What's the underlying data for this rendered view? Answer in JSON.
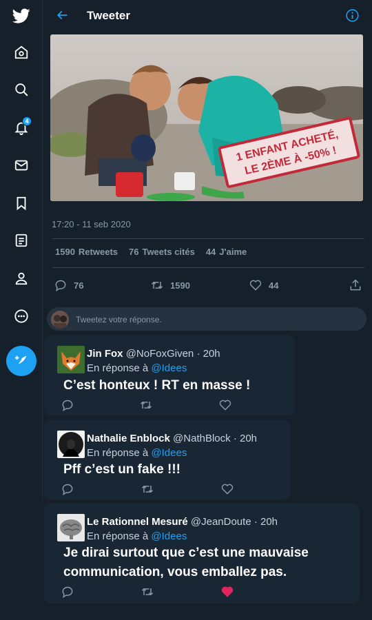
{
  "header": {
    "title": "Tweeter"
  },
  "sidebar": {
    "items": [
      {
        "name": "home"
      },
      {
        "name": "explore"
      },
      {
        "name": "notifications",
        "badge": "4"
      },
      {
        "name": "messages"
      },
      {
        "name": "bookmarks"
      },
      {
        "name": "lists"
      },
      {
        "name": "profile"
      },
      {
        "name": "more"
      }
    ]
  },
  "tweet": {
    "image_text_line1": "1 ENFANT ACHETÉ,",
    "image_text_line2": "LE 2ÈME À -50% !",
    "timestamp": "17:20 - 11 seb 2020",
    "stats": {
      "retweets_count": "1590",
      "retweets_label": "Retweets",
      "quotes_count": "76",
      "quotes_label": "Tweets cités",
      "likes_count": "44",
      "likes_label": "J'aime"
    },
    "actions": {
      "replies": "76",
      "retweets": "1590",
      "likes": "44"
    }
  },
  "reply_box": {
    "placeholder": "Tweetez votre réponse."
  },
  "replies": [
    {
      "name": "Jin Fox",
      "handle": "@NoFoxGiven",
      "time": "· 20h",
      "in_reply_prefix": "En réponse à",
      "mention": "@Idees",
      "text": "C’est honteux ! RT en masse !"
    },
    {
      "name": "Nathalie Enblock",
      "handle": "@NathBlock",
      "time": "· 20h",
      "in_reply_prefix": "En réponse à",
      "mention": "@Idees",
      "text": "Pff c’est un fake !!!"
    },
    {
      "name": "Le Rationnel Mesuré",
      "handle": "@JeanDoute",
      "time": "· 20h",
      "in_reply_prefix": "En réponse à",
      "mention": "@Idees",
      "text_line1": "Je dirai surtout que c’est une mauvaise",
      "text_line2": "communication, vous emballez pas."
    }
  ],
  "colors": {
    "accent": "#1da1f2",
    "background": "#15202b",
    "card": "#192734",
    "liked": "#e0245e"
  }
}
